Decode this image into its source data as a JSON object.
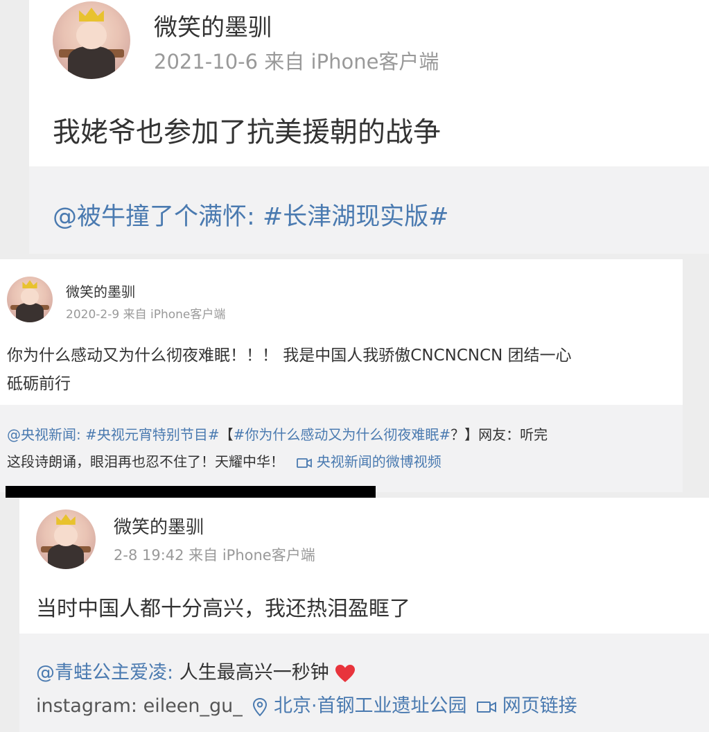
{
  "posts": [
    {
      "username": "微笑的墨驯",
      "meta": "2021-10-6 来自 iPhone客户端",
      "text": "我姥爷也参加了抗美援朝的战争",
      "repost_user": "@被牛撞了个满怀:",
      "repost_tag": "#长津湖现实版#"
    },
    {
      "username": "微笑的墨驯",
      "meta": "2020-2-9 来自 iPhone客户端",
      "text_line1": "你为什么感动又为什么彻夜难眠！！！ 我是中国人我骄傲CNCNCNCN 团结一心",
      "text_line2": "砥砺前行",
      "repost_user": "@央视新闻:",
      "repost_tag1": "#央视元宵特别节目#",
      "repost_bracket_open": "【",
      "repost_tag2": "#你为什么感动又为什么彻夜难眠#",
      "repost_after_tag2": "？】网友：听完",
      "repost_line2": "这段诗朗诵，眼泪再也忍不住了！天耀中华！",
      "video_link": "央视新闻的微博视频"
    },
    {
      "username": "微笑的墨驯",
      "meta": "2-8 19:42 来自 iPhone客户端",
      "text": "当时中国人都十分高兴，我还热泪盈眶了",
      "repost_user": "@青蛙公主爱凌:",
      "repost_text": "人生最高兴一秒钟",
      "repost_line2": "instagram: eileen_gu_",
      "location": "北京·首钢工业遗址公园",
      "web_link": "网页链接"
    }
  ],
  "colors": {
    "link": "#4a7ab0",
    "meta": "#999999",
    "heart": "#e8343c"
  },
  "icons": [
    "location-pin-icon",
    "video-camera-icon",
    "heart-icon"
  ]
}
